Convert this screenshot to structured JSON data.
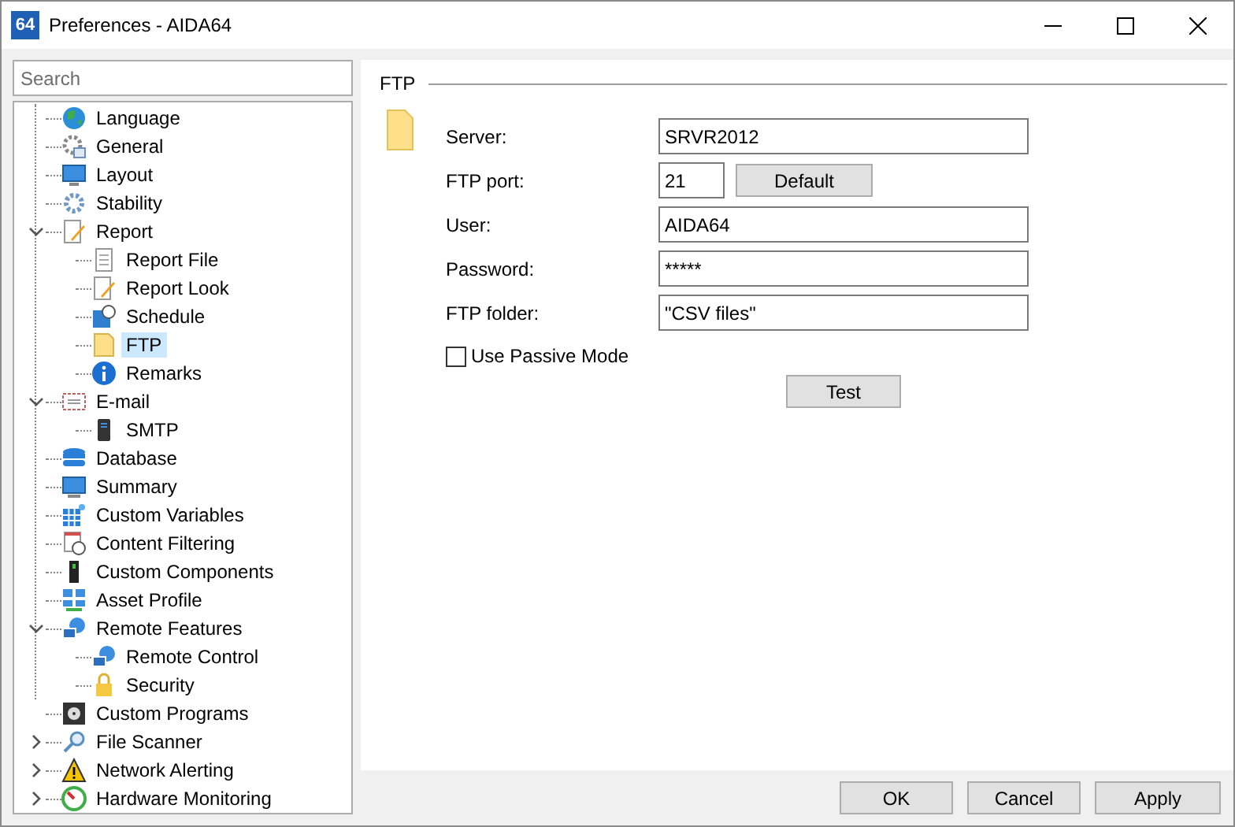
{
  "window": {
    "app_badge": "64",
    "title": "Preferences - AIDA64"
  },
  "search": {
    "placeholder": "Search"
  },
  "tree": [
    {
      "label": "Language",
      "selected": false
    },
    {
      "label": "General",
      "selected": false
    },
    {
      "label": "Layout",
      "selected": false
    },
    {
      "label": "Stability",
      "selected": false
    },
    {
      "label": "Report",
      "selected": false,
      "expanded": true,
      "children": [
        {
          "label": "Report File",
          "selected": false
        },
        {
          "label": "Report Look",
          "selected": false
        },
        {
          "label": "Schedule",
          "selected": false
        },
        {
          "label": "FTP",
          "selected": true
        },
        {
          "label": "Remarks",
          "selected": false
        }
      ]
    },
    {
      "label": "E-mail",
      "selected": false,
      "expanded": true,
      "children": [
        {
          "label": "SMTP",
          "selected": false
        }
      ]
    },
    {
      "label": "Database",
      "selected": false
    },
    {
      "label": "Summary",
      "selected": false
    },
    {
      "label": "Custom Variables",
      "selected": false
    },
    {
      "label": "Content Filtering",
      "selected": false
    },
    {
      "label": "Custom Components",
      "selected": false
    },
    {
      "label": "Asset Profile",
      "selected": false
    },
    {
      "label": "Remote Features",
      "selected": false,
      "expanded": true,
      "children": [
        {
          "label": "Remote Control",
          "selected": false
        },
        {
          "label": "Security",
          "selected": false
        }
      ]
    },
    {
      "label": "Custom Programs",
      "selected": false
    },
    {
      "label": "File Scanner",
      "selected": false,
      "expanded": false
    },
    {
      "label": "Network Alerting",
      "selected": false,
      "expanded": false
    },
    {
      "label": "Hardware Monitoring",
      "selected": false,
      "expanded": false
    }
  ],
  "section": {
    "title": "FTP",
    "fields": [
      {
        "label": "Server:",
        "value": "SRVR2012"
      },
      {
        "label": "FTP port:",
        "value": "21",
        "button": "Default"
      },
      {
        "label": "User:",
        "value": "AIDA64"
      },
      {
        "label": "Password:",
        "value": "*****"
      },
      {
        "label": "FTP folder:",
        "value": "\"CSV files\""
      }
    ],
    "passive_mode": {
      "label": "Use Passive Mode",
      "checked": false
    },
    "test_button": "Test"
  },
  "buttons": [
    "OK",
    "Cancel",
    "Apply"
  ]
}
